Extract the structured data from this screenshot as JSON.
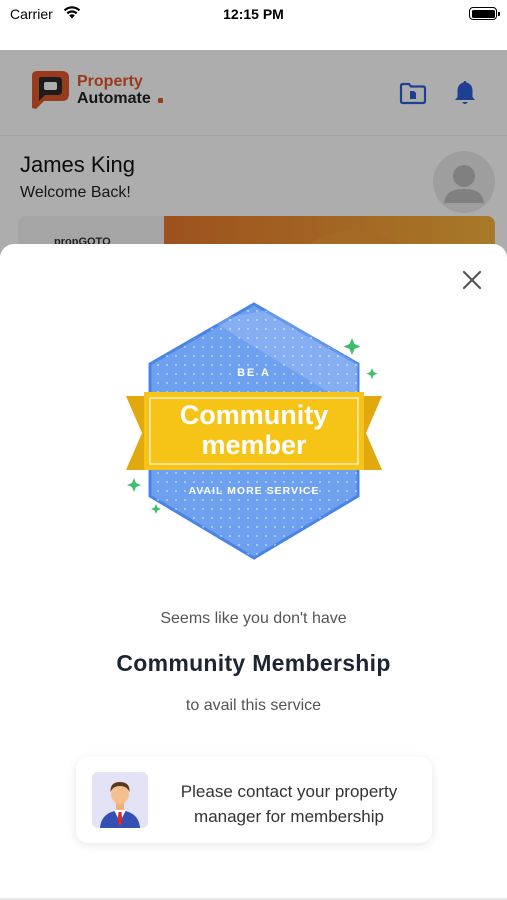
{
  "status_bar": {
    "carrier": "Carrier",
    "time": "12:15 PM"
  },
  "app": {
    "brand_line1": "Property",
    "brand_line2": "Automate",
    "user_name": "James King",
    "welcome": "Welcome Back!",
    "banner_brand": "propGOTO"
  },
  "modal": {
    "badge_top": "BE A",
    "badge_title_line1": "Community",
    "badge_title_line2": "member",
    "badge_bottom": "AVAIL MORE SERVICE",
    "line1": "Seems like you don't have",
    "title": "Community Membership",
    "line3": "to avail this service",
    "contact_line1": "Please contact your property",
    "contact_line2": "manager for membership"
  },
  "colors": {
    "brand_orange": "#e0572a",
    "accent_blue": "#2f5fd6",
    "badge_blue": "#6ea0f0",
    "ribbon_yellow": "#f6c417",
    "sparkle_green": "#3fbf6a"
  }
}
